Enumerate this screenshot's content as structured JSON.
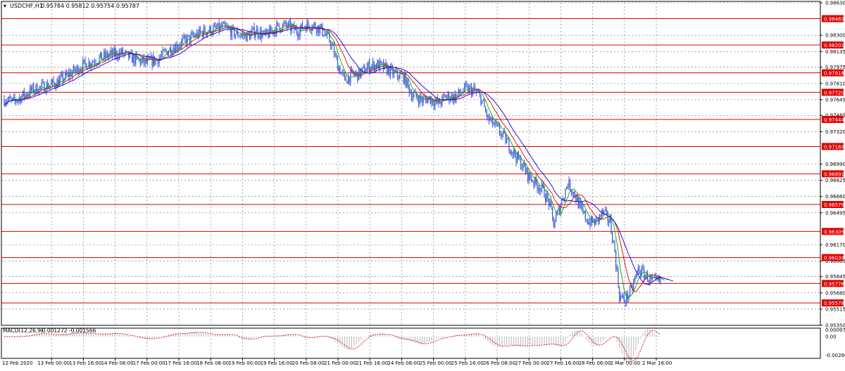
{
  "header": {
    "symbol_label": "USDCHF,H1",
    "ohlc_text": "0.95784 0.95812 0.95754 0.95787"
  },
  "macd": {
    "label": "MACD(12,26,9)",
    "values_text": "-0.001272 -0.001566",
    "axis_ticks": [
      "0.00097",
      "0.00",
      "-0.00266"
    ],
    "axis_tick_values": [
      0.00097,
      0.0,
      -0.00266
    ],
    "ylim": [
      -0.0031,
      0.0012
    ]
  },
  "colors": {
    "bull": "#3b5bd6",
    "bear": "#3b5bd6",
    "ma_fast": "#00b000",
    "ma_mid": "#e00000",
    "ma_slow": "#0000e0",
    "level_line": "#e00000",
    "level_label_bg": "#e00000",
    "grid": "#333333",
    "macd_hist": "#b8b8b8",
    "macd_signal": "#e00000"
  },
  "chart_data": {
    "type": "candlestick",
    "title": "USDCHF,H1",
    "ylim": [
      0.9535,
      0.9863
    ],
    "price_ticks": [
      {
        "label": "0.98630",
        "value": 0.9863
      },
      {
        "label": "0.98300",
        "value": 0.983
      },
      {
        "label": "0.98135",
        "value": 0.98135
      },
      {
        "label": "0.97975",
        "value": 0.97975
      },
      {
        "label": "0.97810",
        "value": 0.9781
      },
      {
        "label": "0.97645",
        "value": 0.97645
      },
      {
        "label": "0.97485",
        "value": 0.97485
      },
      {
        "label": "0.97320",
        "value": 0.9732
      },
      {
        "label": "0.96990",
        "value": 0.9699
      },
      {
        "label": "0.96825",
        "value": 0.96825
      },
      {
        "label": "0.96660",
        "value": 0.9666
      },
      {
        "label": "0.96495",
        "value": 0.96495
      },
      {
        "label": "0.96170",
        "value": 0.9617
      },
      {
        "label": "0.96005",
        "value": 0.96005
      },
      {
        "label": "0.95845",
        "value": 0.95845
      },
      {
        "label": "0.95680",
        "value": 0.9568
      },
      {
        "label": "0.95515",
        "value": 0.95515
      },
      {
        "label": "0.95350",
        "value": 0.9535
      }
    ],
    "levels": [
      {
        "label": "0.98469",
        "value": 0.98469
      },
      {
        "label": "0.98201",
        "value": 0.98201
      },
      {
        "label": "0.97918",
        "value": 0.97918
      },
      {
        "label": "0.97720",
        "value": 0.9772
      },
      {
        "label": "0.97444",
        "value": 0.97444
      },
      {
        "label": "0.97169",
        "value": 0.97169
      },
      {
        "label": "0.96891",
        "value": 0.96891
      },
      {
        "label": "0.96579",
        "value": 0.96579
      },
      {
        "label": "0.96305",
        "value": 0.96305
      },
      {
        "label": "0.96039",
        "value": 0.96039
      },
      {
        "label": "0.95776",
        "value": 0.95776
      },
      {
        "label": "0.95578",
        "value": 0.95578
      }
    ],
    "x_labels": [
      "12 Feb 2020",
      "13 Feb 00:00",
      "13 Feb 16:00",
      "14 Feb 08:00",
      "17 Feb 00:00",
      "17 Feb 16:00",
      "18 Feb 08:00",
      "19 Feb 00:00",
      "19 Feb 16:00",
      "20 Feb 08:00",
      "21 Feb 00:00",
      "21 Feb 16:00",
      "24 Feb 08:00",
      "25 Feb 00:00",
      "25 Feb 16:00",
      "26 Feb 08:00",
      "27 Feb 00:00",
      "27 Feb 16:00",
      "28 Feb 08:00",
      "2 Mar 00:00",
      "2 Mar 16:00"
    ],
    "price_path": [
      [
        0,
        0.9765
      ],
      [
        8,
        0.9762
      ],
      [
        15,
        0.9768
      ],
      [
        25,
        0.9775
      ],
      [
        35,
        0.9778
      ],
      [
        45,
        0.9782
      ],
      [
        55,
        0.979
      ],
      [
        65,
        0.9798
      ],
      [
        78,
        0.9805
      ],
      [
        90,
        0.981
      ],
      [
        100,
        0.9812
      ],
      [
        110,
        0.9806
      ],
      [
        120,
        0.9802
      ],
      [
        130,
        0.9805
      ],
      [
        140,
        0.9815
      ],
      [
        150,
        0.9822
      ],
      [
        160,
        0.9828
      ],
      [
        170,
        0.9834
      ],
      [
        180,
        0.9836
      ],
      [
        186,
        0.9838
      ],
      [
        196,
        0.9832
      ],
      [
        208,
        0.9829
      ],
      [
        214,
        0.9835
      ],
      [
        222,
        0.9829
      ],
      [
        232,
        0.9838
      ],
      [
        240,
        0.984
      ],
      [
        250,
        0.9834
      ],
      [
        256,
        0.984
      ],
      [
        264,
        0.984
      ],
      [
        270,
        0.9836
      ],
      [
        278,
        0.9823
      ],
      [
        284,
        0.98
      ],
      [
        290,
        0.9784
      ],
      [
        296,
        0.979
      ],
      [
        302,
        0.979
      ],
      [
        310,
        0.9798
      ],
      [
        318,
        0.98
      ],
      [
        325,
        0.9796
      ],
      [
        333,
        0.979
      ],
      [
        340,
        0.9788
      ],
      [
        347,
        0.977
      ],
      [
        356,
        0.9764
      ],
      [
        362,
        0.9766
      ],
      [
        370,
        0.976
      ],
      [
        376,
        0.9768
      ],
      [
        384,
        0.9767
      ],
      [
        392,
        0.9775
      ],
      [
        400,
        0.9774
      ],
      [
        406,
        0.9766
      ],
      [
        412,
        0.9745
      ],
      [
        420,
        0.9735
      ],
      [
        428,
        0.9722
      ],
      [
        434,
        0.971
      ],
      [
        440,
        0.97
      ],
      [
        446,
        0.9688
      ],
      [
        452,
        0.968
      ],
      [
        458,
        0.9674
      ],
      [
        464,
        0.966
      ],
      [
        468,
        0.9638
      ],
      [
        474,
        0.9658
      ],
      [
        480,
        0.968
      ],
      [
        486,
        0.9668
      ],
      [
        492,
        0.965
      ],
      [
        498,
        0.964
      ],
      [
        504,
        0.964
      ],
      [
        510,
        0.965
      ],
      [
        516,
        0.964
      ],
      [
        520,
        0.961
      ],
      [
        524,
        0.9565
      ],
      [
        528,
        0.956
      ],
      [
        534,
        0.957
      ],
      [
        540,
        0.9592
      ],
      [
        546,
        0.9586
      ],
      [
        552,
        0.9579
      ]
    ]
  }
}
